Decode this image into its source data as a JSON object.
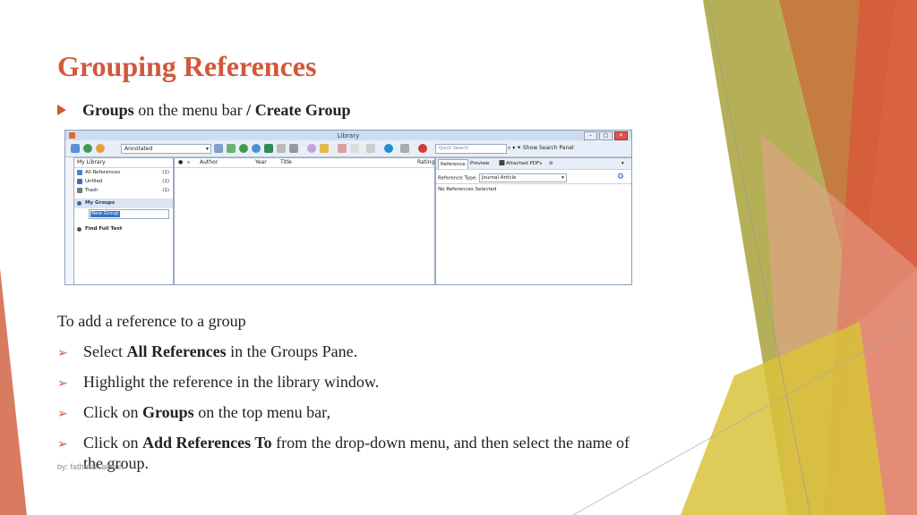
{
  "slide": {
    "title": "Grouping References",
    "bullet1": {
      "bold1": "Groups",
      "text": " on the menu bar ",
      "sep": "/",
      "bold2": " Create Group"
    },
    "intro": "To add a reference to a group",
    "steps": [
      {
        "pre": "Select ",
        "bold": "All References",
        "post": " in the Groups Pane."
      },
      {
        "pre": "Highlight the reference in the library window.",
        "bold": "",
        "post": ""
      },
      {
        "pre": "Click on ",
        "bold": "Groups",
        "post": " on the top menu bar,"
      },
      {
        "pre": "Click on ",
        "bold": "Add References To",
        "post": " from the drop-down menu, and then select the name of"
      }
    ],
    "step4_cont": "the group.",
    "footer": "by: fathmah alamri",
    "accent_color": "#d0593b"
  },
  "screenshot": {
    "window_title": "Library",
    "library_select": "Annotated",
    "quick_search_placeholder": "Quick Search",
    "show_search_panel": "Show Search Panel",
    "groups_pane": {
      "header": "My Library",
      "items": [
        {
          "label": "All References",
          "count": "(1)"
        },
        {
          "label": "Unfiled",
          "count": "(1)"
        },
        {
          "label": "Trash",
          "count": "(1)"
        }
      ],
      "my_groups": "My Groups",
      "new_group": "New Group",
      "find_full_text": "Find Full Text"
    },
    "columns": {
      "author": "Author",
      "year": "Year",
      "title": "Title",
      "rating": "Rating"
    },
    "ref_tabs": {
      "reference": "Reference",
      "preview": "Preview",
      "attached": "Attached PDFs"
    },
    "reference_type_label": "Reference Type:",
    "reference_type_value": "Journal Article",
    "no_refs": "No References Selected"
  }
}
